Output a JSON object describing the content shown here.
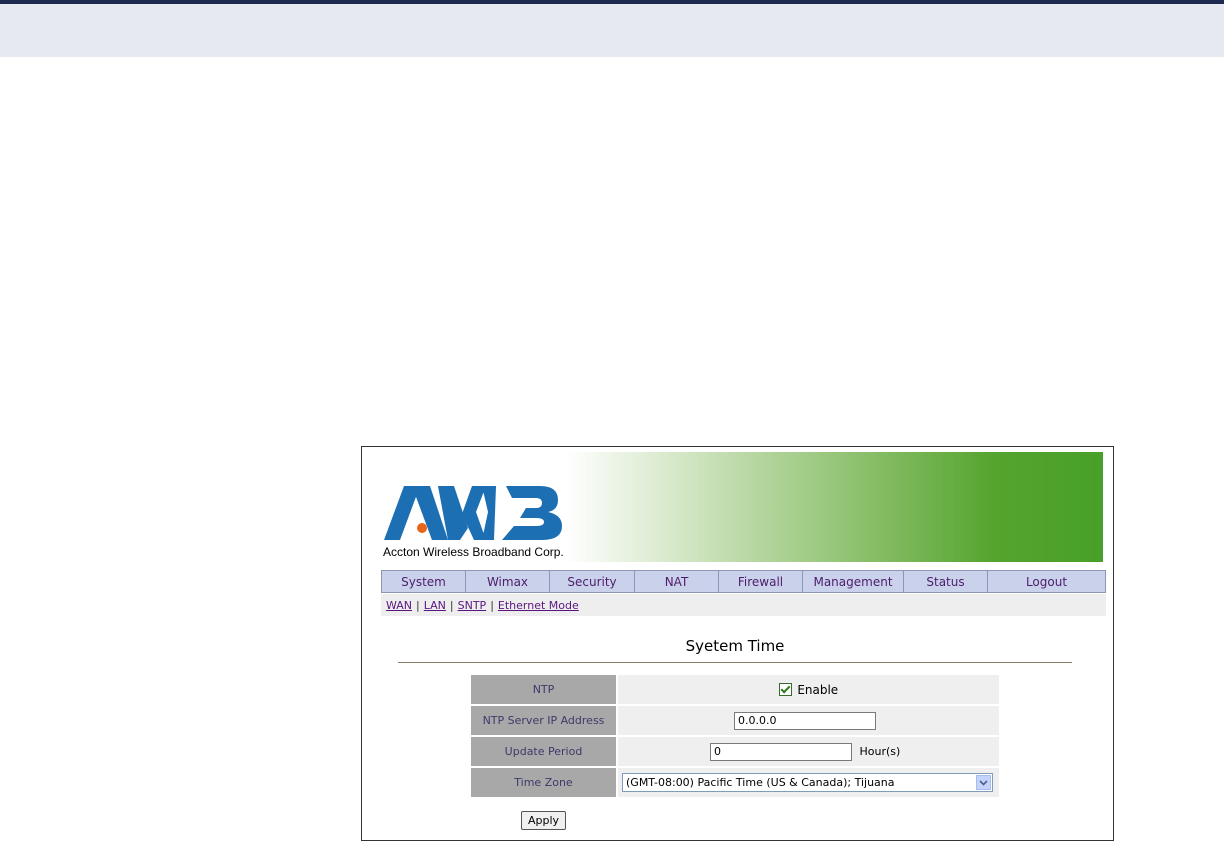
{
  "brand": {
    "logo_text": "AWB",
    "caption": "Accton Wireless Broadband Corp."
  },
  "nav": {
    "items": [
      {
        "label": "System"
      },
      {
        "label": "Wimax"
      },
      {
        "label": "Security"
      },
      {
        "label": "NAT"
      },
      {
        "label": "Firewall"
      },
      {
        "label": "Management"
      },
      {
        "label": "Status"
      },
      {
        "label": "Logout"
      }
    ]
  },
  "subnav": {
    "links": [
      {
        "label": "WAN"
      },
      {
        "label": "LAN"
      },
      {
        "label": "SNTP"
      },
      {
        "label": "Ethernet Mode"
      }
    ],
    "separator": "|"
  },
  "page": {
    "title": "Syetem Time"
  },
  "form": {
    "ntp": {
      "label": "NTP",
      "enable_label": "Enable",
      "enabled": true
    },
    "server": {
      "label": "NTP Server IP Address",
      "value": "0.0.0.0"
    },
    "update": {
      "label": "Update Period",
      "value": "0",
      "unit": "Hour(s)"
    },
    "timezone": {
      "label": "Time Zone",
      "selected": "(GMT-08:00) Pacific Time (US & Canada); Tijuana"
    },
    "apply_label": "Apply"
  },
  "icons": {
    "checkbox": "checkbox-checked-icon",
    "dropdown": "chevron-down-icon"
  },
  "colors": {
    "nav_bg": "#c9d2ea",
    "nav_text": "#4e1c6c",
    "label_bg": "#a8a8a8",
    "value_bg": "#efefef",
    "banner_green": "#48a028",
    "logo_blue": "#1d6fb3"
  }
}
